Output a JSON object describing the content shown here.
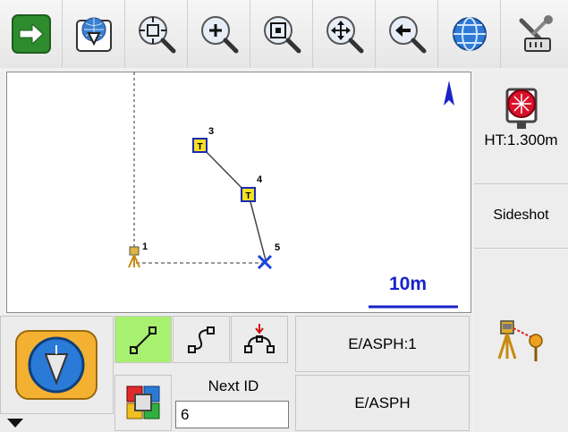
{
  "toolbar": {
    "buttons": [
      {
        "name": "next-arrow-button",
        "icon": "right-arrow-icon"
      },
      {
        "name": "download-button",
        "icon": "download-globe-icon"
      },
      {
        "name": "zoom-extents-button",
        "icon": "zoom-extents-icon"
      },
      {
        "name": "zoom-in-button",
        "icon": "zoom-in-icon"
      },
      {
        "name": "zoom-window-button",
        "icon": "zoom-window-icon"
      },
      {
        "name": "pan-button",
        "icon": "pan-icon"
      },
      {
        "name": "zoom-previous-button",
        "icon": "zoom-previous-icon"
      },
      {
        "name": "globe-button",
        "icon": "globe-icon"
      },
      {
        "name": "settings-button",
        "icon": "tools-icon"
      }
    ]
  },
  "map": {
    "points": [
      {
        "id": "1",
        "type": "instrument"
      },
      {
        "id": "3",
        "type": "traverse"
      },
      {
        "id": "4",
        "type": "traverse"
      },
      {
        "id": "5",
        "type": "sideshot"
      }
    ],
    "scale_label": "10m",
    "north_icon": "north-arrow-icon",
    "colors": {
      "scale": "#1a22c8",
      "point_fill": "#f4e024",
      "point_border": "#1a2ab0"
    }
  },
  "side": {
    "ht_label": "HT:1.300m",
    "sideshot_label": "Sideshot"
  },
  "bottom": {
    "codes_button_icon": "code-list-icon",
    "mode_buttons": [
      {
        "icon": "line-mode-icon",
        "active": true
      },
      {
        "icon": "curve-mode-icon",
        "active": false
      },
      {
        "icon": "arc-mode-icon",
        "active": false
      }
    ],
    "code_button_1": "E/ASPH:1",
    "code_button_2": "E/ASPH",
    "next_id_label": "Next ID",
    "next_id_value": "6"
  }
}
